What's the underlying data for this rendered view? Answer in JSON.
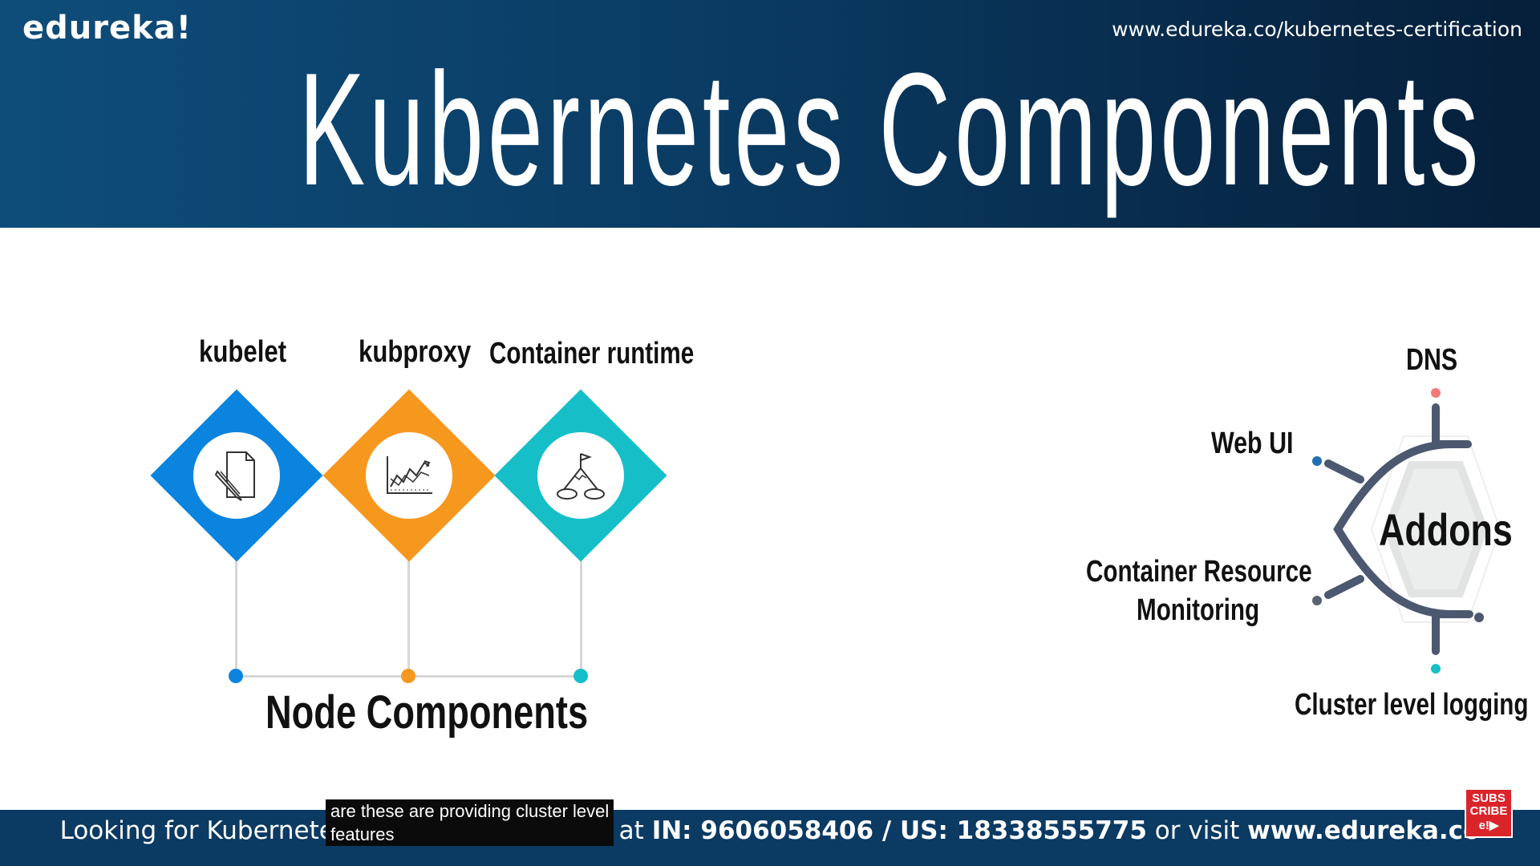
{
  "header": {
    "logo": "edureka!",
    "url": "www.edureka.co/kubernetes-certification",
    "title": "Kubernetes Components"
  },
  "node_components": {
    "title": "Node Components",
    "items": [
      {
        "label": "kubelet",
        "color": "#0b84df",
        "icon": "document-pen-icon"
      },
      {
        "label": "kubproxy",
        "color": "#f7981e",
        "icon": "line-chart-icon"
      },
      {
        "label": "Container runtime",
        "color": "#16bfc8",
        "icon": "mountain-flag-icon"
      }
    ]
  },
  "addons": {
    "center": "Addons",
    "items": [
      {
        "label": "DNS",
        "color": "#f47a7a"
      },
      {
        "label": "Web UI",
        "color": "#1f6fb2"
      },
      {
        "label_line1": "Container Resource",
        "label_line2": "Monitoring",
        "color": "#5b6272"
      },
      {
        "label": "Cluster level logging",
        "color": "#16bfc8"
      }
    ],
    "hub_color": "#4c5870"
  },
  "caption": {
    "line1": "are these are providing cluster level",
    "line2": "features"
  },
  "footer": {
    "prefix": "Looking for Kubernetes Certification? Call us at ",
    "phone": "IN: 9606058406 / US: 18338555775",
    "mid": " or visit ",
    "site": "www.edureka.co"
  },
  "subscribe": {
    "line1": "SUBS",
    "line2": "CRIBE",
    "line3": "e!▶"
  }
}
